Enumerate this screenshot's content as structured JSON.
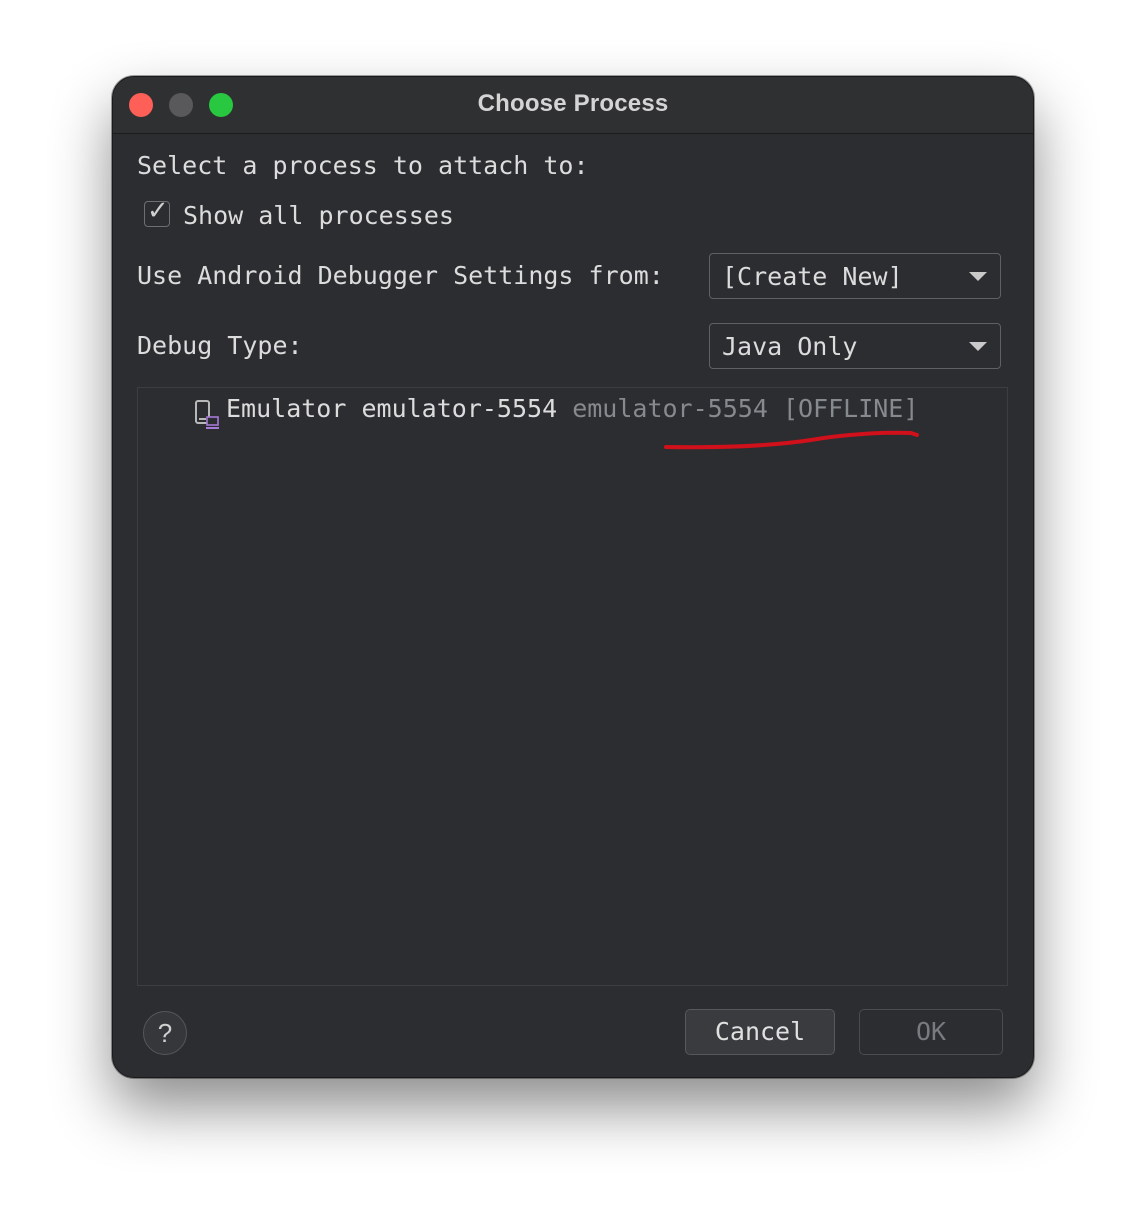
{
  "window": {
    "title": "Choose Process"
  },
  "prompt": "Select a process to attach to:",
  "show_all": {
    "label": "Show all processes",
    "checked": true
  },
  "debugger_settings": {
    "label": "Use Android Debugger Settings from:",
    "value": "[Create New]"
  },
  "debug_type": {
    "label": "Debug Type:",
    "value": "Java Only"
  },
  "devices": [
    {
      "icon": "device-icon",
      "name": "Emulator emulator-5554",
      "serial": "emulator-5554",
      "status": "[OFFLINE]"
    }
  ],
  "annotation": {
    "color": "#d0101a"
  },
  "footer": {
    "help": "?",
    "cancel": "Cancel",
    "ok": "OK"
  },
  "colors": {
    "close": "#fe5f57",
    "minimize": "#59595b",
    "maximize": "#28c840",
    "background": "#2b2d30"
  }
}
